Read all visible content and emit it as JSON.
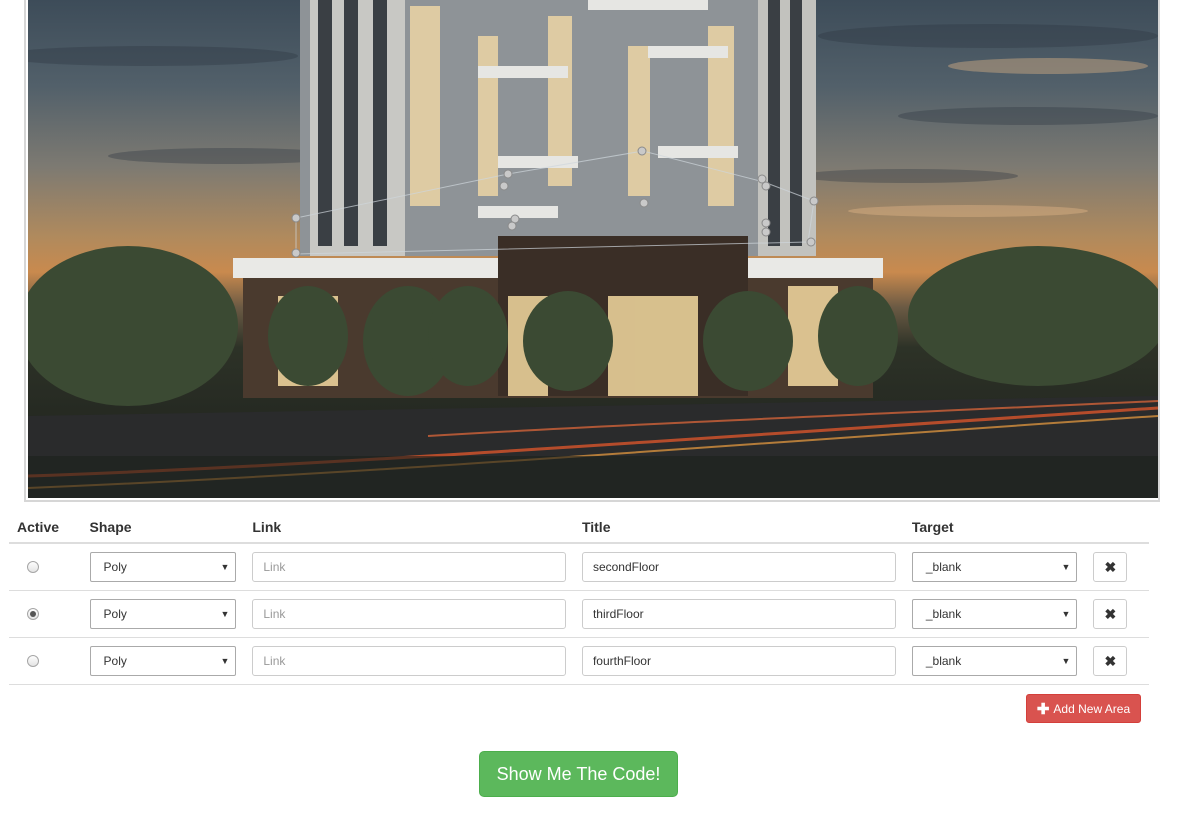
{
  "table": {
    "headers": {
      "active": "Active",
      "shape": "Shape",
      "link": "Link",
      "title": "Title",
      "target": "Target"
    },
    "rows": [
      {
        "active": false,
        "shape": "Poly",
        "link_value": "",
        "link_placeholder": "Link",
        "title": "secondFloor",
        "target": "_blank"
      },
      {
        "active": true,
        "shape": "Poly",
        "link_value": "",
        "link_placeholder": "Link",
        "title": "thirdFloor",
        "target": "_blank"
      },
      {
        "active": false,
        "shape": "Poly",
        "link_value": "",
        "link_placeholder": "Link",
        "title": "fourthFloor",
        "target": "_blank"
      }
    ]
  },
  "buttons": {
    "add_area": "Add New Area",
    "show_code": "Show Me The Code!"
  },
  "icons": {
    "delete": "times-icon",
    "add": "plus-icon",
    "select_arrow": "caret-down-icon"
  },
  "colors": {
    "danger": "#d9534f",
    "success": "#5cb85c"
  }
}
